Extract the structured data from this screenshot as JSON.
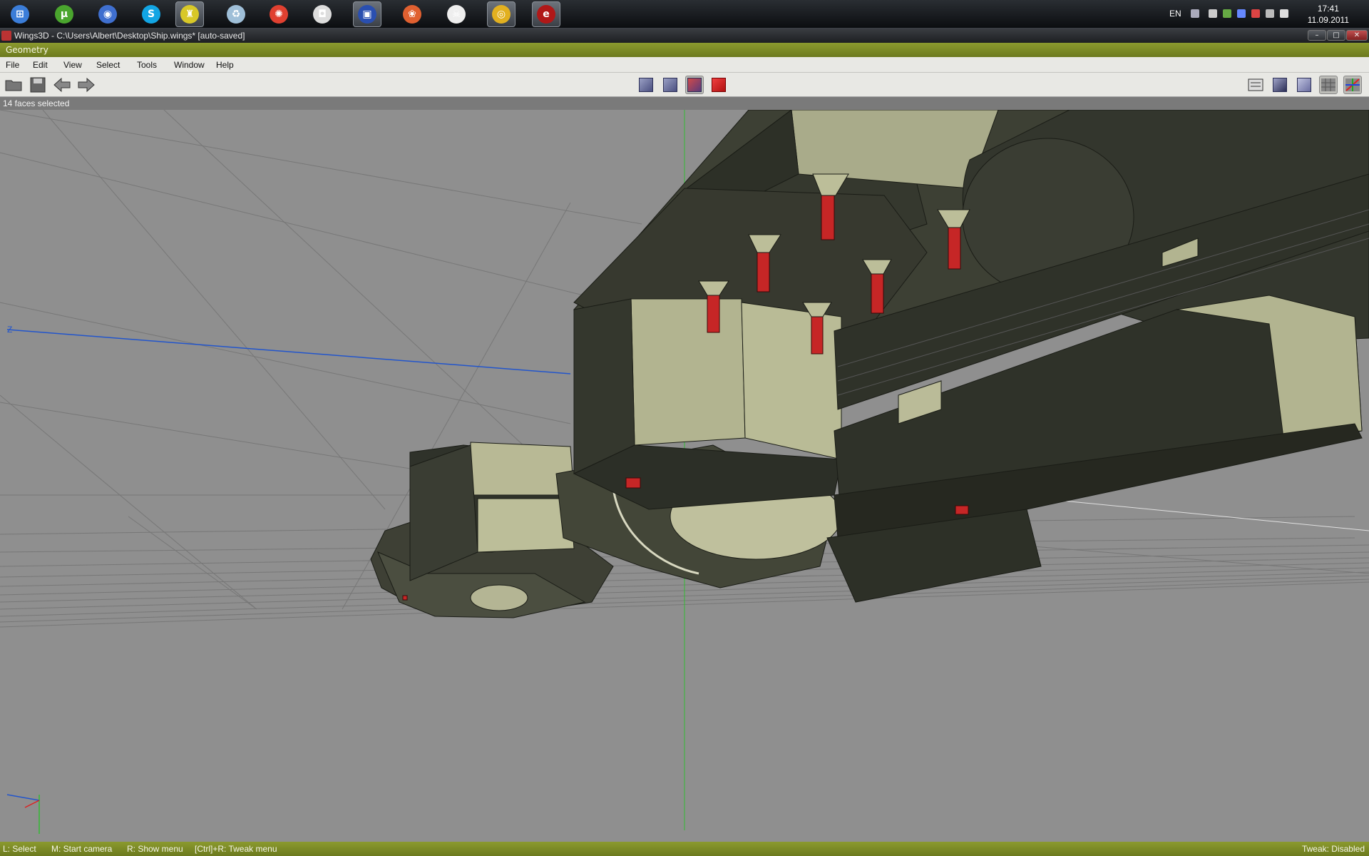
{
  "taskbar": {
    "apps": [
      {
        "name": "start-orb",
        "glyph": "⊞",
        "color": "#3b7dd8"
      },
      {
        "name": "utorrent",
        "glyph": "µ",
        "color": "#4aa52e"
      },
      {
        "name": "google-earth",
        "glyph": "◉",
        "color": "#3f6fcf"
      },
      {
        "name": "skype",
        "glyph": "S",
        "color": "#12a5e4"
      },
      {
        "name": "app-yellow",
        "glyph": "♜",
        "color": "#d8c828"
      },
      {
        "name": "recycle-bin",
        "glyph": "♻",
        "color": "#9fbfd8"
      },
      {
        "name": "app-red-swirl",
        "glyph": "✺",
        "color": "#e04030"
      },
      {
        "name": "speaker-app",
        "glyph": "◘",
        "color": "#dddddd"
      },
      {
        "name": "floppy-save",
        "glyph": "▣",
        "color": "#2a4fb0"
      },
      {
        "name": "app-fire",
        "glyph": "❀",
        "color": "#e06030"
      },
      {
        "name": "wings3d",
        "glyph": "☠",
        "color": "#eeeeee"
      },
      {
        "name": "chrome",
        "glyph": "◎",
        "color": "#e2b020"
      },
      {
        "name": "erlang",
        "glyph": "e",
        "color": "#b01818"
      }
    ],
    "lang": "EN",
    "time": "17:41",
    "date": "11.09.2011"
  },
  "window": {
    "title": "Wings3D - C:\\Users\\Albert\\Desktop\\Ship.wings* [auto-saved]",
    "geometry_label": "Geometry"
  },
  "menu": [
    "File",
    "Edit",
    "View",
    "Select",
    "Tools",
    "Window",
    "Help"
  ],
  "status": {
    "selection": "14 faces selected"
  },
  "viewport": {
    "axis_z_label": "Z"
  },
  "info": {
    "hints": [
      "L: Select",
      "M: Start camera",
      "R: Show menu",
      "[Ctrl]+R: Tweak menu"
    ],
    "tweak": "Tweak: Disabled"
  }
}
